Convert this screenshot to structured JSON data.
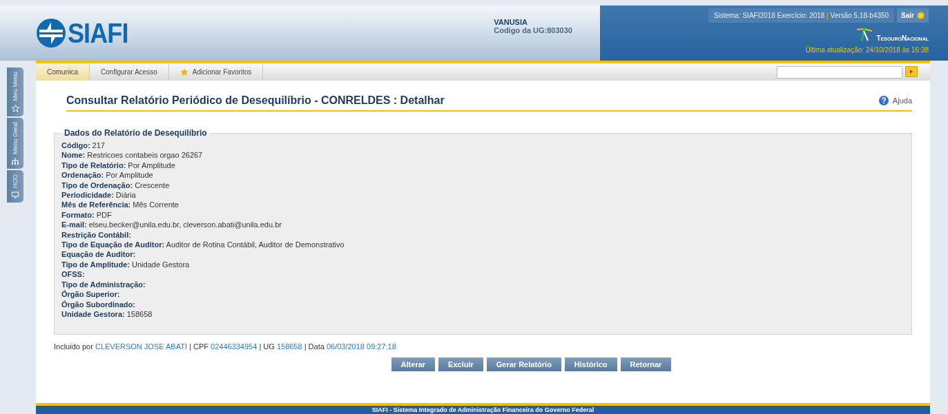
{
  "header": {
    "logo": "SIAFI",
    "user": "VANUSIA",
    "ug_label": "Codigo da UG:",
    "ug_value": "803030",
    "system_info": "Sistema: SIAFI2018 Exercício: 2018",
    "separator": "|",
    "version_info": "Versão 5.18-b4350",
    "logout": "Sair",
    "brand": "TesouroNacional",
    "last_update": "Última atualização: 24/10/2018 às 16:38"
  },
  "menu": [
    {
      "label": "Comunica",
      "selected": true,
      "kind": "plain"
    },
    {
      "label": "Configurar Acesso",
      "selected": false,
      "kind": "plain"
    },
    {
      "label": "Adicionar Favoritos",
      "selected": false,
      "kind": "star"
    }
  ],
  "side_tabs": [
    {
      "label": "Meu Menu",
      "kind": "star"
    },
    {
      "label": "Menu Geral",
      "kind": "tree"
    },
    {
      "label": "HOD",
      "kind": "monitor"
    }
  ],
  "page": {
    "title": "Consultar Relatório Periódico de Desequilíbrio - CONRELDES : Detalhar",
    "help": "Ajuda"
  },
  "details": {
    "legend": "Dados do Relatório de Desequilíbrio",
    "fields": [
      {
        "label": "Código:",
        "value": "217"
      },
      {
        "label": "Nome:",
        "value": "Restricoes contabeis orgao 26267"
      },
      {
        "label": "Tipo de Relatório:",
        "value": "Por Amplitude"
      },
      {
        "label": "Ordenação:",
        "value": "Por Amplitude"
      },
      {
        "label": "Tipo de Ordenação:",
        "value": "Crescente"
      },
      {
        "label": "Periodicidade:",
        "value": "Diária"
      },
      {
        "label": "Mês de Referência:",
        "value": "Mês Corrente"
      },
      {
        "label": "Formato:",
        "value": "PDF"
      },
      {
        "label": "E-mail:",
        "value": "elseu.becker@unila.edu.br, cleverson.abati@unila.edu.br"
      },
      {
        "label": "Restrição Contábil:"
      },
      {
        "label": "Tipo de Equação de Auditor:",
        "value": "Auditor de Rotina Contábil, Auditor de Demonstrativo"
      },
      {
        "label": "Equação de Auditor:"
      },
      {
        "label": "Tipo de Amplitude:",
        "value": "Unidade Gestora"
      },
      {
        "label": "OFSS:"
      },
      {
        "label": "Tipo de Administração:"
      },
      {
        "label": "Órgão Superior:"
      },
      {
        "label": "Órgão Subordinado:"
      },
      {
        "label": "Unidade Gestora:",
        "value": "158658"
      }
    ]
  },
  "audit": [
    {
      "label": "Incluido por",
      "value": "CLEVERSON JOSE ABATI"
    },
    {
      "separator": "|",
      "label": "CPF",
      "value": "02446334954"
    },
    {
      "separator": "|",
      "label": "UG",
      "value": "158658"
    },
    {
      "separator": "|",
      "label": "Data",
      "value": "06/03/2018 09:27:18"
    }
  ],
  "buttons": [
    "Alterar",
    "Excluir",
    "Gerar Relatório",
    "Histórico",
    "Retornar"
  ],
  "footer": "SIAFI - Sistema Integrado de Administração Financeira do Governo Federal"
}
